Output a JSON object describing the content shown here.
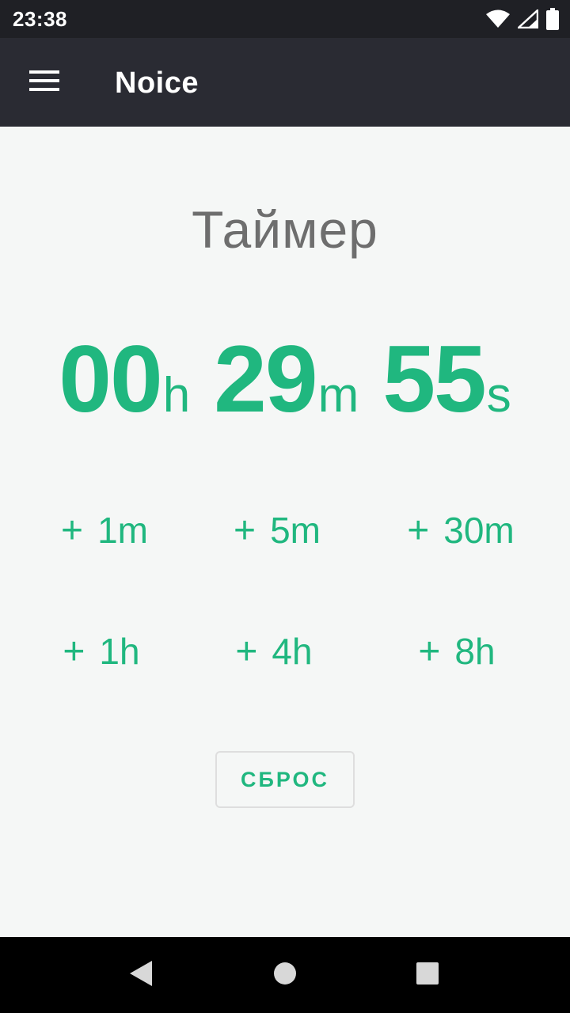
{
  "status_bar": {
    "time": "23:38",
    "icons": [
      "wifi-icon",
      "cellular-signal-icon",
      "battery-icon"
    ]
  },
  "app_bar": {
    "title": "Noice",
    "menu_icon": "hamburger-menu-icon"
  },
  "timer": {
    "title": "Таймер",
    "hours": "00",
    "hours_unit": "h",
    "minutes": "29",
    "minutes_unit": "m",
    "seconds": "55",
    "seconds_unit": "s"
  },
  "add_buttons": [
    {
      "plus": "+",
      "label": "1m"
    },
    {
      "plus": "+",
      "label": "5m"
    },
    {
      "plus": "+",
      "label": "30m"
    },
    {
      "plus": "+",
      "label": "1h"
    },
    {
      "plus": "+",
      "label": "4h"
    },
    {
      "plus": "+",
      "label": "8h"
    }
  ],
  "reset_button": {
    "label": "СБРОС"
  },
  "nav_bar": {
    "icons": [
      "back-icon",
      "home-icon",
      "recents-icon"
    ]
  },
  "colors": {
    "accent": "#20b77f",
    "app_bar": "#2a2b33",
    "status_bar": "#1f2025",
    "background": "#f5f7f6",
    "title_text": "#6e6e6e"
  }
}
